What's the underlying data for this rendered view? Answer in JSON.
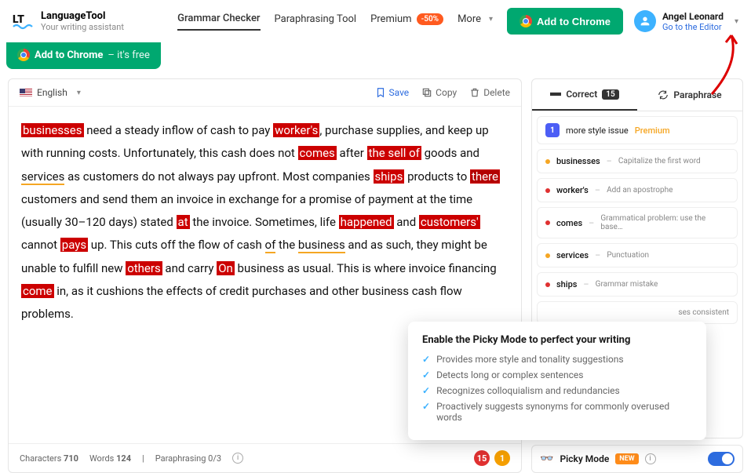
{
  "brand": {
    "name": "LanguageTool",
    "tagline": "Your writing assistant"
  },
  "nav": {
    "grammar": "Grammar Checker",
    "paraphrase": "Paraphrasing Tool",
    "premium": "Premium",
    "sale": "-50%",
    "more": "More"
  },
  "cta": {
    "chrome": "Add to Chrome",
    "chrome_free": "– it's free"
  },
  "user": {
    "name": "Angel Leonard",
    "editor_link": "Go to the Editor"
  },
  "toolbar": {
    "language": "English",
    "save": "Save",
    "copy": "Copy",
    "delete": "Delete"
  },
  "editor": {
    "segments": [
      {
        "t": "businesses",
        "c": "hl"
      },
      {
        "t": " need a steady inflow of cash to pay "
      },
      {
        "t": "worker's",
        "c": "hl"
      },
      {
        "t": ", purchase supplies, and keep up with running costs. Unfortunately, this cash does not "
      },
      {
        "t": "comes",
        "c": "hl"
      },
      {
        "t": " after "
      },
      {
        "t": "the sell of",
        "c": "hl"
      },
      {
        "t": " goods and "
      },
      {
        "t": "services",
        "c": "ul-orange"
      },
      {
        "t": " as customers do not always pay upfront. Most companies "
      },
      {
        "t": "ships",
        "c": "hl"
      },
      {
        "t": " products to "
      },
      {
        "t": "there",
        "c": "hl-out"
      },
      {
        "t": " customers and send them an invoice in exchange for a promise of payment at the time (usually 30–120 days) stated "
      },
      {
        "t": "at",
        "c": "hl"
      },
      {
        "t": " the invoice. Sometimes, life "
      },
      {
        "t": "happened",
        "c": "hl"
      },
      {
        "t": " and "
      },
      {
        "t": "customers'",
        "c": "hl"
      },
      {
        "t": " cannot "
      },
      {
        "t": "pays",
        "c": "hl"
      },
      {
        "t": " up. This cuts off the flow of cash "
      },
      {
        "t": "of",
        "c": "ul-orange"
      },
      {
        "t": " the "
      },
      {
        "t": "business",
        "c": "ul-orange"
      },
      {
        "t": " and as such, they might be unable to fulfill new "
      },
      {
        "t": "others",
        "c": "hl"
      },
      {
        "t": " and carry "
      },
      {
        "t": "On",
        "c": "hl"
      },
      {
        "t": " business as usual. This is where invoice financing "
      },
      {
        "t": "come",
        "c": "hl"
      },
      {
        "t": " in, as it cushions the effects of credit purchases and other business cash flow problems."
      }
    ]
  },
  "footer": {
    "chars_label": "Characters",
    "chars": "710",
    "words_label": "Words",
    "words": "124",
    "para_label": "Paraphrasing",
    "para": "0/3",
    "badge_red": "15",
    "badge_orange": "1"
  },
  "tabs": {
    "correct": "Correct",
    "correct_count": "15",
    "paraphrase": "Paraphrase"
  },
  "suggestions": {
    "more": {
      "count": "1",
      "text": "more style issue",
      "premium": "Premium"
    },
    "items": [
      {
        "word": "businesses",
        "desc": "Capitalize the first word",
        "dot": "orange"
      },
      {
        "word": "worker's",
        "desc": "Add an apostrophe",
        "dot": "red"
      },
      {
        "word": "comes",
        "desc": "Grammatical problem: use the base…",
        "dot": "red"
      },
      {
        "word": "services",
        "desc": "Punctuation",
        "dot": "orange"
      },
      {
        "word": "ships",
        "desc": "Grammar mistake",
        "dot": "red"
      }
    ],
    "partial": "ses consistent"
  },
  "picky": {
    "label": "Picky Mode",
    "new": "NEW",
    "tooltip_title": "Enable the Picky Mode to perfect your writing",
    "tooltip_items": [
      "Provides more style and tonality suggestions",
      "Detects long or complex sentences",
      "Recognizes colloquialism and redundancies",
      "Proactively suggests synonyms for commonly overused words"
    ]
  }
}
